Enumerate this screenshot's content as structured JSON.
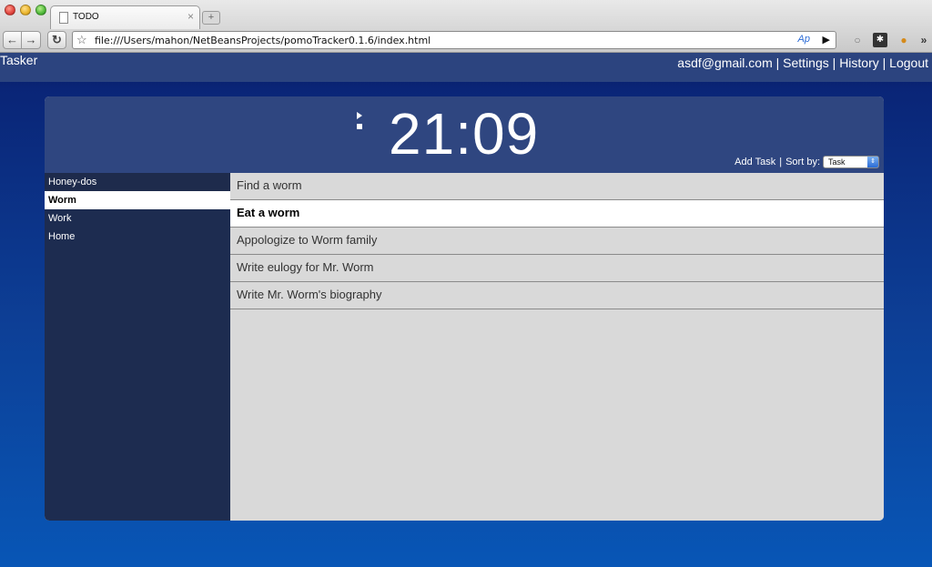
{
  "browser": {
    "tab_title": "TODO",
    "tab_close": "×",
    "new_tab": "+",
    "url": "file:///Users/mahon/NetBeansProjects/pomoTracker0.1.6/index.html",
    "reader_glyph": "Ap",
    "play_glyph": "▶",
    "more_glyph": "»"
  },
  "app": {
    "brand": "Tasker",
    "user_email": "asdf@gmail.com",
    "settings": "Settings",
    "history": "History",
    "logout": "Logout",
    "separator": "|"
  },
  "timer": {
    "display": "21:09"
  },
  "controls": {
    "add_task": "Add Task",
    "separator": "|",
    "sort_label": "Sort by:",
    "sort_value": "Task"
  },
  "lists": [
    {
      "label": "Honey-dos"
    },
    {
      "label": "Worm"
    },
    {
      "label": "Work"
    },
    {
      "label": "Home"
    }
  ],
  "tasks": [
    {
      "label": "Find a worm"
    },
    {
      "label": "Eat a worm"
    },
    {
      "label": "Appologize to Worm family"
    },
    {
      "label": "Write eulogy for Mr. Worm"
    },
    {
      "label": "Write Mr. Worm's biography"
    }
  ],
  "colors": {
    "topbar": "#2c447f",
    "panel_header": "#2f4680",
    "sidebar": "#1d2c50",
    "task_area": "#d9d9d9"
  }
}
